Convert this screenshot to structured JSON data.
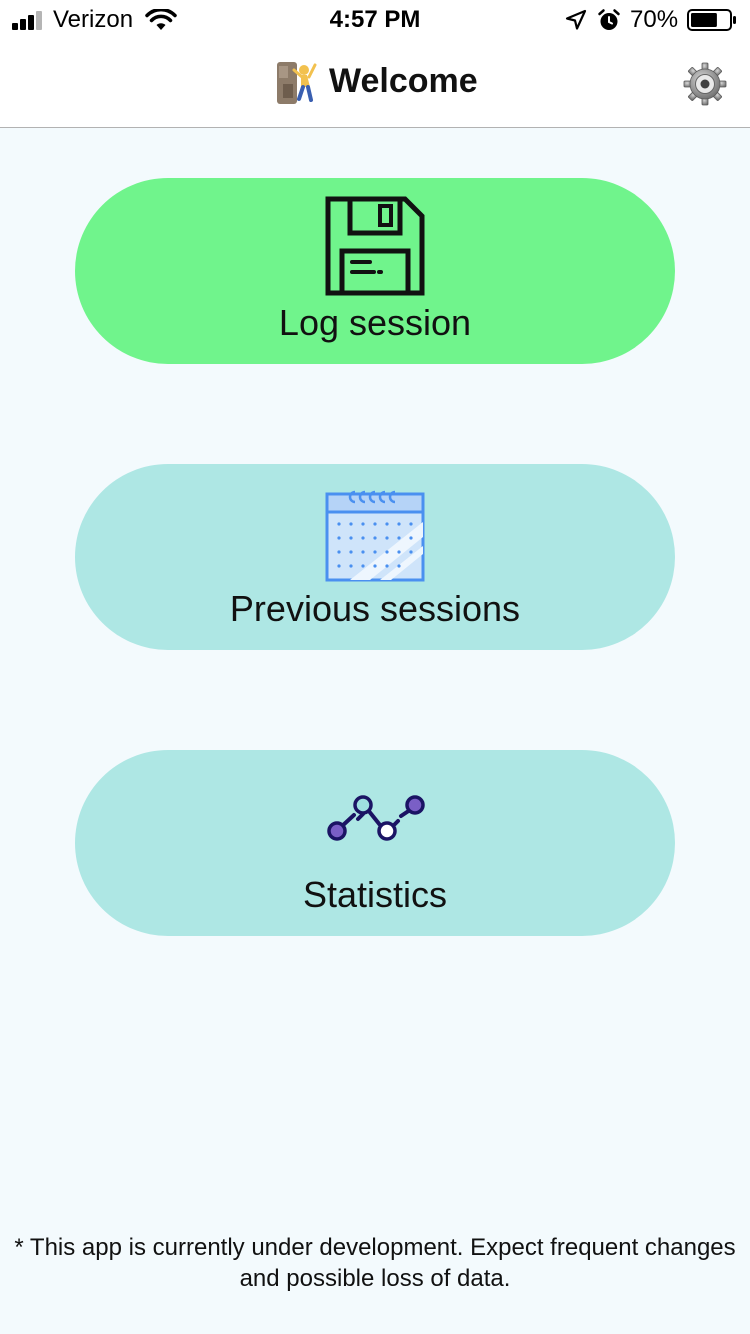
{
  "status_bar": {
    "carrier": "Verizon",
    "time": "4:57 PM",
    "battery": "70%",
    "battery_level": 0.7,
    "signal_strength": 3,
    "signal_bars_total": 4,
    "icons": [
      "signal-icon",
      "wifi-icon",
      "location-arrow-icon",
      "alarm-icon",
      "battery-icon"
    ]
  },
  "nav": {
    "title": "Welcome",
    "title_emoji": "climber-emoji-icon",
    "settings_icon": "gear-icon"
  },
  "menu": [
    {
      "label": "Log session",
      "icon": "floppy-disk-icon",
      "color": "#70f48c"
    },
    {
      "label": "Previous sessions",
      "icon": "calendar-icon",
      "color": "#aee7e4"
    },
    {
      "label": "Statistics",
      "icon": "line-chart-icon",
      "color": "#aee7e4"
    }
  ],
  "footer": {
    "note": "* This app is currently under development. Expect frequent changes and possible loss of data."
  },
  "colors": {
    "background": "#f3fafd",
    "log_button": "#70f48c",
    "secondary_button": "#aee7e4"
  }
}
